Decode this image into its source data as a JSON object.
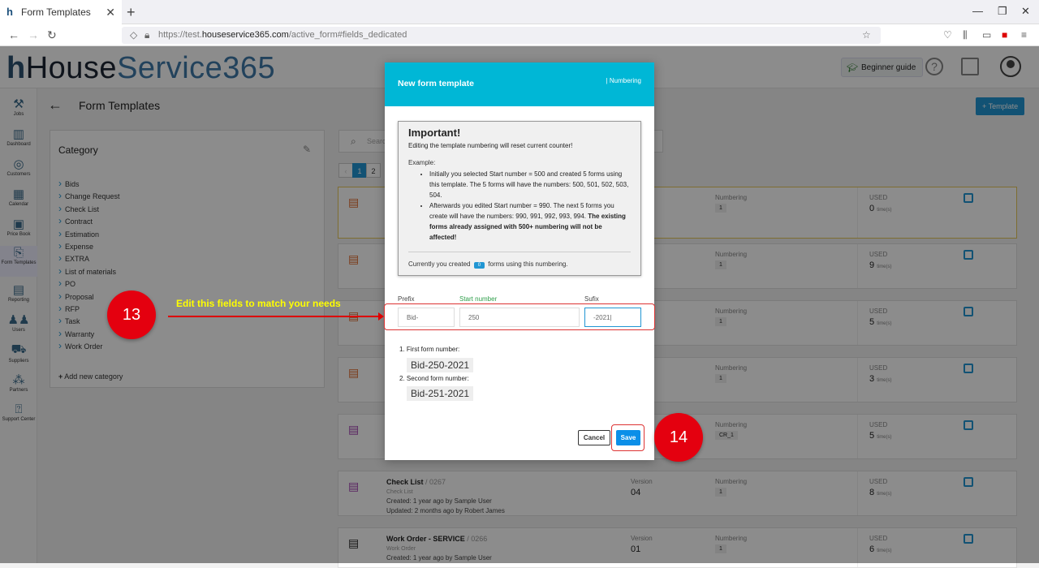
{
  "browser": {
    "tab_title": "Form Templates",
    "url_prefix": "https://test.",
    "url_domain": "houseservice365.com",
    "url_path": "/active_form#fields_dedicated"
  },
  "app": {
    "logo_h": "h",
    "logo_dark": "House",
    "logo_blue": "Service365",
    "beginner_guide": "Beginner guide",
    "page_title": "Form Templates",
    "add_template": "+ Template"
  },
  "sidebar": {
    "items": [
      {
        "label": "Jobs"
      },
      {
        "label": "Dashboard"
      },
      {
        "label": "Customers"
      },
      {
        "label": "Calendar"
      },
      {
        "label": "Price Book"
      },
      {
        "label": "Form Templates"
      },
      {
        "label": "Reporting"
      },
      {
        "label": "Users"
      },
      {
        "label": "Suppliers"
      },
      {
        "label": "Partners"
      },
      {
        "label": "Support Center"
      }
    ]
  },
  "category": {
    "title": "Category",
    "items": [
      "Bids",
      "Change Request",
      "Check List",
      "Contract",
      "Estimation",
      "Expense",
      "EXTRA",
      "List of materials",
      "PO",
      "Proposal",
      "RFP",
      "Task",
      "Warranty",
      "Work Order"
    ],
    "add_new": "Add new category"
  },
  "list": {
    "search_placeholder": "Search",
    "pages": [
      "1",
      "2"
    ],
    "version_label": "Version",
    "numbering_label": "Numbering",
    "used_label": "USED",
    "times_label": "time(s)",
    "cards": [
      {
        "numbering": "1",
        "used": "0"
      },
      {
        "numbering": "1",
        "used": "9"
      },
      {
        "numbering": "1",
        "used": "5"
      },
      {
        "numbering": "1",
        "used": "3"
      },
      {
        "numbering": "CR_1",
        "used": "5"
      },
      {
        "name": "Check List",
        "id": "/ 0267",
        "category": "Check List",
        "created": "Created: 1 year ago by Sample User",
        "updated": "Updated: 2 months ago by Robert James",
        "version": "04",
        "numbering": "1",
        "used": "8"
      },
      {
        "name": "Work Order - SERVICE",
        "id": "/ 0266",
        "category": "Work Order",
        "created": "Created: 1 year ago by Sample User",
        "version": "01",
        "numbering": "1",
        "used": "6"
      }
    ]
  },
  "modal": {
    "title": "New form template",
    "subtitle": "| Numbering",
    "important_title": "Important!",
    "warning": "Editing the template numbering will reset current counter!",
    "example_label": "Example:",
    "bullet1": "Initially you selected Start number = 500 and created 5 forms using this template. The 5 forms will have the numbers: 500, 501, 502, 503, 504.",
    "bullet2_pre": "Afterwards you edited Start number = 990. The next 5 forms you create will have the numbers: 990, 991, 992, 993, 994. ",
    "bullet2_bold": "The existing forms already assigned with 500+ numbering will not be affected!",
    "created_pre": "Currently you created",
    "created_count": "0",
    "created_post": "forms using this numbering.",
    "prefix_label": "Prefix",
    "start_label": "Start number",
    "suffix_label": "Sufix",
    "prefix_value": "Bid-",
    "start_value": "250",
    "suffix_value": "-2021|",
    "first_label": "1. First form number:",
    "first_value": "Bid-250-2021",
    "second_label": "2. Second form number:",
    "second_value": "Bid-251-2021",
    "cancel": "Cancel",
    "save": "Save"
  },
  "annotations": {
    "step13": "13",
    "step13_text": "Edit this fields to match your needs",
    "step14": "14"
  },
  "colors": {
    "modal_header": "#00b7d6",
    "primary": "#2196d3",
    "callout_red": "#e4000f",
    "callout_text": "#ffff00"
  }
}
